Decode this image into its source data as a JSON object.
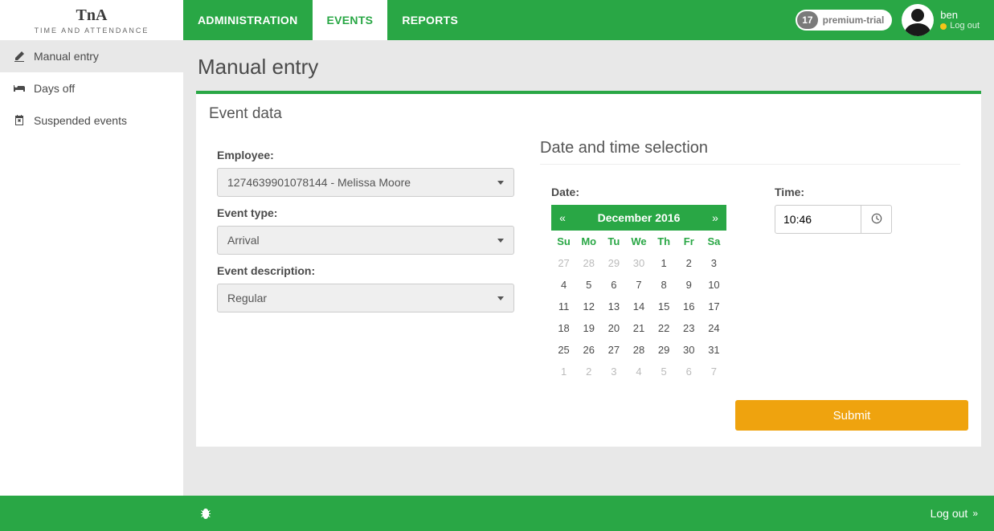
{
  "brand": {
    "top": "TnA",
    "sub": "TIME AND ATTENDANCE"
  },
  "nav": {
    "items": [
      {
        "label": "ADMINISTRATION"
      },
      {
        "label": "EVENTS"
      },
      {
        "label": "REPORTS"
      }
    ],
    "active_index": 1
  },
  "trial_badge": {
    "count": "17",
    "label": "premium-trial"
  },
  "user": {
    "name": "ben",
    "logout_label": "Log out",
    "status_color": "#f5c518"
  },
  "sidebar": {
    "items": [
      {
        "label": "Manual entry",
        "icon": "edit"
      },
      {
        "label": "Days off",
        "icon": "bed"
      },
      {
        "label": "Suspended events",
        "icon": "calendar-x"
      }
    ],
    "active_index": 0
  },
  "page": {
    "title": "Manual entry",
    "card_title": "Event data",
    "labels": {
      "employee": "Employee:",
      "event_type": "Event type:",
      "event_description": "Event description:"
    },
    "values": {
      "employee": "1274639901078144 - Melissa Moore",
      "event_type": "Arrival",
      "event_description": "Regular"
    },
    "datetime": {
      "heading": "Date and time selection",
      "date_label": "Date:",
      "time_label": "Time:",
      "time_value": "10:46"
    },
    "submit_label": "Submit"
  },
  "calendar": {
    "prev": "«",
    "next": "»",
    "title": "December 2016",
    "dow": [
      "Su",
      "Mo",
      "Tu",
      "We",
      "Th",
      "Fr",
      "Sa"
    ],
    "weeks": [
      [
        {
          "d": "27",
          "m": true
        },
        {
          "d": "28",
          "m": true
        },
        {
          "d": "29",
          "m": true
        },
        {
          "d": "30",
          "m": true
        },
        {
          "d": "1"
        },
        {
          "d": "2"
        },
        {
          "d": "3"
        }
      ],
      [
        {
          "d": "4"
        },
        {
          "d": "5"
        },
        {
          "d": "6"
        },
        {
          "d": "7"
        },
        {
          "d": "8"
        },
        {
          "d": "9"
        },
        {
          "d": "10"
        }
      ],
      [
        {
          "d": "11"
        },
        {
          "d": "12"
        },
        {
          "d": "13"
        },
        {
          "d": "14"
        },
        {
          "d": "15"
        },
        {
          "d": "16"
        },
        {
          "d": "17"
        }
      ],
      [
        {
          "d": "18"
        },
        {
          "d": "19"
        },
        {
          "d": "20"
        },
        {
          "d": "21"
        },
        {
          "d": "22"
        },
        {
          "d": "23"
        },
        {
          "d": "24"
        }
      ],
      [
        {
          "d": "25"
        },
        {
          "d": "26"
        },
        {
          "d": "27"
        },
        {
          "d": "28"
        },
        {
          "d": "29"
        },
        {
          "d": "30"
        },
        {
          "d": "31"
        }
      ],
      [
        {
          "d": "1",
          "m": true
        },
        {
          "d": "2",
          "m": true
        },
        {
          "d": "3",
          "m": true
        },
        {
          "d": "4",
          "m": true
        },
        {
          "d": "5",
          "m": true
        },
        {
          "d": "6",
          "m": true
        },
        {
          "d": "7",
          "m": true
        }
      ]
    ]
  },
  "footer": {
    "logout_label": "Log out"
  }
}
